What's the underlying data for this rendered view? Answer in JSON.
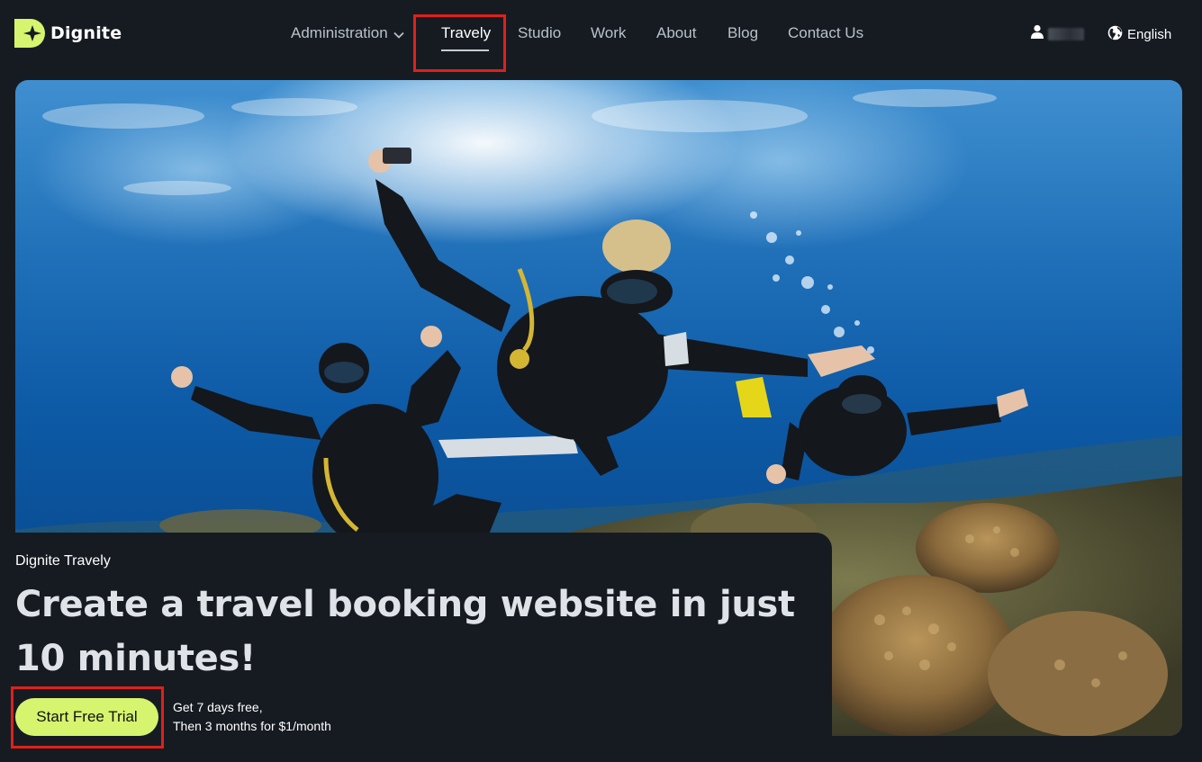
{
  "brand": {
    "name": "Dignite",
    "accent": "#d6f46e"
  },
  "nav": {
    "items": [
      {
        "label": "Administration",
        "has_dropdown": true
      },
      {
        "label": "Travely",
        "active": true
      },
      {
        "label": "Studio"
      },
      {
        "label": "Work"
      },
      {
        "label": "About"
      },
      {
        "label": "Blog"
      },
      {
        "label": "Contact Us"
      }
    ],
    "dropdown_icon": "chevron-down-icon"
  },
  "user": {
    "icon": "user-icon"
  },
  "language": {
    "icon": "globe-icon",
    "label": "English"
  },
  "hero": {
    "image": "scuba-divers-underwater",
    "subtitle": "Dignite Travely",
    "title": "Create a travel booking website in just 10 minutes!",
    "cta_label": "Start Free Trial",
    "cta_note_line1": "Get 7 days free,",
    "cta_note_line2": "Then 3 months for $1/month"
  },
  "highlight_color": "#e0201b"
}
